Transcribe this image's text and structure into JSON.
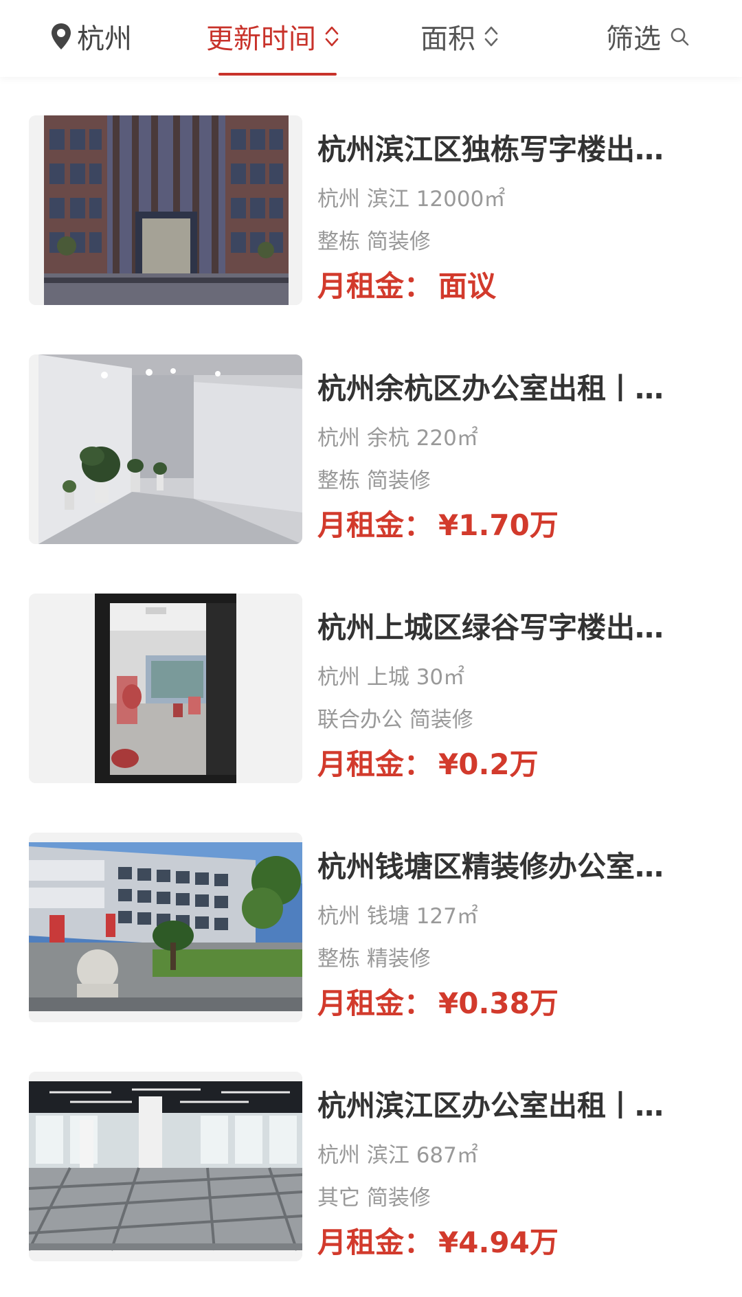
{
  "filters": {
    "city": "杭州",
    "update_time": "更新时间",
    "area": "面积",
    "filter": "筛选"
  },
  "colors": {
    "accent": "#c8322a",
    "price": "#d23a2c",
    "title": "#333333",
    "meta": "#999999"
  },
  "listings": [
    {
      "title": "杭州滨江区独栋写字楼出…",
      "location": "杭州 滨江 12000㎡",
      "tags": "整栋 简装修",
      "price_label": "月租金：",
      "price_value": "面议",
      "image": "building-exterior-photo"
    },
    {
      "title": "杭州余杭区办公室出租丨…",
      "location": "杭州 余杭 220㎡",
      "tags": "整栋 简装修",
      "price_label": "月租金：",
      "price_value": "¥1.70万",
      "image": "office-lobby-photo"
    },
    {
      "title": "杭州上城区绿谷写字楼出…",
      "location": "杭州 上城 30㎡",
      "tags": "联合办公 简装修",
      "price_label": "月租金：",
      "price_value": "¥0.2万",
      "image": "office-doorway-photo"
    },
    {
      "title": "杭州钱塘区精装修办公室…",
      "location": "杭州 钱塘 127㎡",
      "tags": "整栋 精装修",
      "price_label": "月租金：",
      "price_value": "¥0.38万",
      "image": "office-building-courtyard-photo"
    },
    {
      "title": "杭州滨江区办公室出租丨…",
      "location": "杭州 滨江 687㎡",
      "tags": "其它 简装修",
      "price_label": "月租金：",
      "price_value": "¥4.94万",
      "image": "open-office-floor-photo"
    }
  ]
}
